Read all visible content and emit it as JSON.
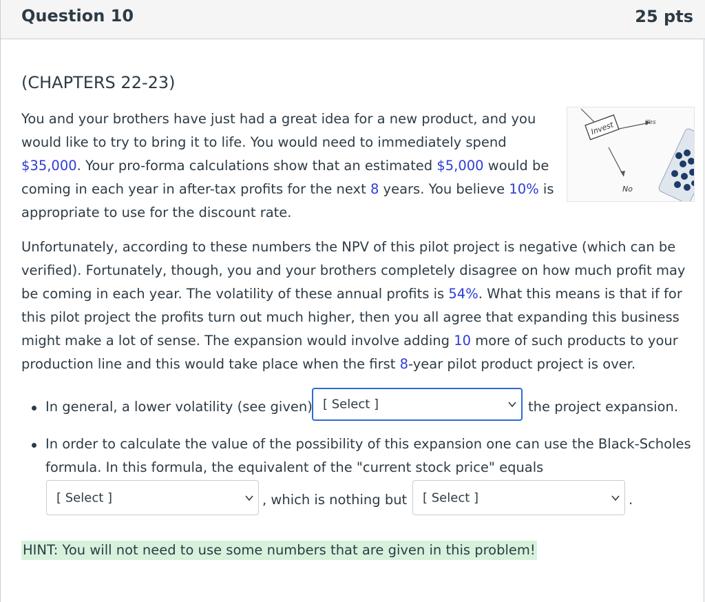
{
  "question": {
    "title": "Question 10",
    "points": "25 pts"
  },
  "chapters": "(CHAPTERS 22-23)",
  "para1": {
    "t1": "You and your brothers have just had a great idea for a new product, and you would like to try to bring it to life. You would need to immediately spend ",
    "v1": "$35,000",
    "t2": ". Your pro-forma calculations show that an estimated ",
    "v2": "$5,000",
    "t3": " would be coming in each year in after-tax profits for the next ",
    "v3": "8",
    "t4": " years. You believe ",
    "v4": "10%",
    "t5": " is appropriate to use for the discount rate."
  },
  "para2": {
    "t1": "Unfortunately, according to these numbers the NPV of this pilot project is negative (which can be verified). Fortunately, though, you and your brothers completely disagree on how much profit may be coming in each year. The volatility of these annual profits is ",
    "v1": "54%",
    "t2": ". What this means is that if for this pilot project the profits turn out much higher, then you all agree that expanding this business might make a lot of sense. The expansion would involve adding ",
    "v2": "10",
    "t3": " more of such products to your production line and this would take place when the first ",
    "v3": "8",
    "t4": "-year pilot product project is over."
  },
  "figure": {
    "invest": "Invest",
    "yes": "Yes",
    "no": "No"
  },
  "bullet1": {
    "before": "In general, a lower volatility (see given)",
    "select": "[ Select ]",
    "after": "the project expansion."
  },
  "bullet2": {
    "line1": "In order to calculate the value of the possibility of this expansion one can use the Black-Scholes",
    "line2": "formula. In this formula, the equivalent of the \"current stock price\" equals",
    "select1": "[ Select ]",
    "mid": ", which is nothing but",
    "select2": "[ Select ]",
    "end": "."
  },
  "hint": "HINT: You will not need to use some numbers that are given in this problem!",
  "colors": {
    "highlight": "#2d3bd8",
    "hint_bg": "#d6f2dc",
    "focus": "#2b6ad8"
  }
}
